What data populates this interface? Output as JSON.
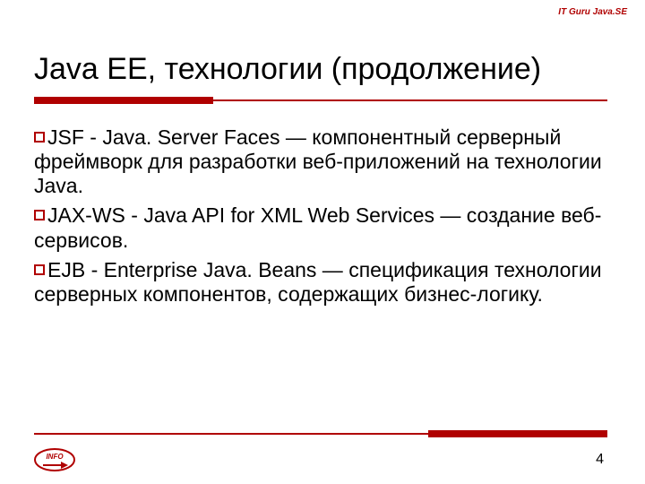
{
  "header": {
    "label": "IT Guru Java.SE"
  },
  "title": "Java EE, технологии (продолжение)",
  "bullets": [
    "JSF - Java. Server Faces — компонентный серверный фреймворк для разработки веб-приложений на технологии Java.",
    "JAX-WS - Java API for XML Web Services — создание веб-сервисов.",
    "EJB - Enterprise Java. Beans — спецификация технологии серверных компонентов, содержащих бизнес-логику."
  ],
  "footer": {
    "page_number": "4",
    "logo_text": "INFO"
  },
  "colors": {
    "accent": "#b00000"
  }
}
